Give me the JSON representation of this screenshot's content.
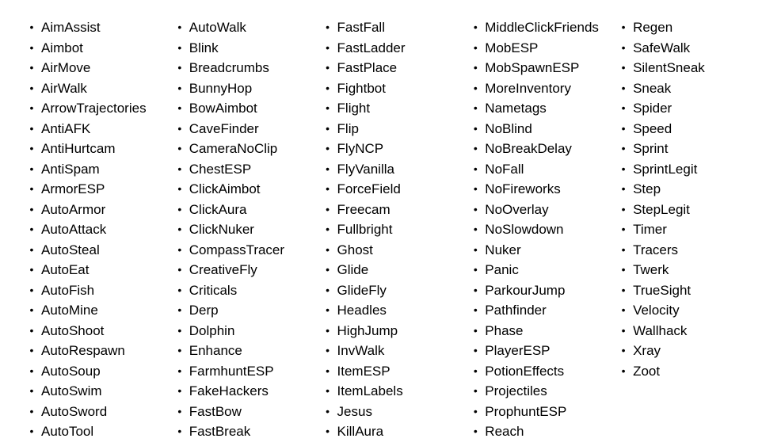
{
  "columns": [
    {
      "items": [
        "AimAssist",
        "Aimbot",
        "AirMove",
        "AirWalk",
        "ArrowTrajectories",
        "AntiAFK",
        "AntiHurtcam",
        "AntiSpam",
        "ArmorESP",
        "AutoArmor",
        "AutoAttack",
        "AutoSteal",
        "AutoEat",
        "AutoFish",
        "AutoMine",
        "AutoShoot",
        "AutoRespawn",
        "AutoSoup",
        "AutoSwim",
        "AutoSword",
        "AutoTool"
      ]
    },
    {
      "items": [
        "AutoWalk",
        "Blink",
        "Breadcrumbs",
        "BunnyHop",
        "BowAimbot",
        "CaveFinder",
        "CameraNoClip",
        "ChestESP",
        "ClickAimbot",
        "ClickAura",
        "ClickNuker",
        "CompassTracer",
        "CreativeFly",
        "Criticals",
        "Derp",
        "Dolphin",
        "Enhance",
        "FarmhuntESP",
        "FakeHackers",
        "FastBow",
        "FastBreak"
      ]
    },
    {
      "items": [
        "FastFall",
        "FastLadder",
        "FastPlace",
        "Fightbot",
        "Flight",
        "Flip",
        "FlyNCP",
        "FlyVanilla",
        "ForceField",
        "Freecam",
        "Fullbright",
        "Ghost",
        "Glide",
        "GlideFly",
        "Headles",
        "HighJump",
        "InvWalk",
        "ItemESP",
        "ItemLabels",
        "Jesus",
        "KillAura"
      ]
    },
    {
      "items": [
        "MiddleClickFriends",
        "MobESP",
        "MobSpawnESP",
        "MoreInventory",
        "Nametags",
        "NoBlind",
        "NoBreakDelay",
        "NoFall",
        "NoFireworks",
        "NoOverlay",
        "NoSlowdown",
        "Nuker",
        "Panic",
        "ParkourJump",
        "Pathfinder",
        "Phase",
        "PlayerESP",
        "PotionEffects",
        "Projectiles",
        "ProphuntESP",
        "Reach"
      ]
    },
    {
      "items": [
        "Regen",
        "SafeWalk",
        "SilentSneak",
        "Sneak",
        "Spider",
        "Speed",
        "Sprint",
        "SprintLegit",
        "Step",
        "StepLegit",
        "Timer",
        "Tracers",
        "Twerk",
        "TrueSight",
        "Velocity",
        "Wallhack",
        "Xray",
        "Zoot"
      ]
    }
  ]
}
